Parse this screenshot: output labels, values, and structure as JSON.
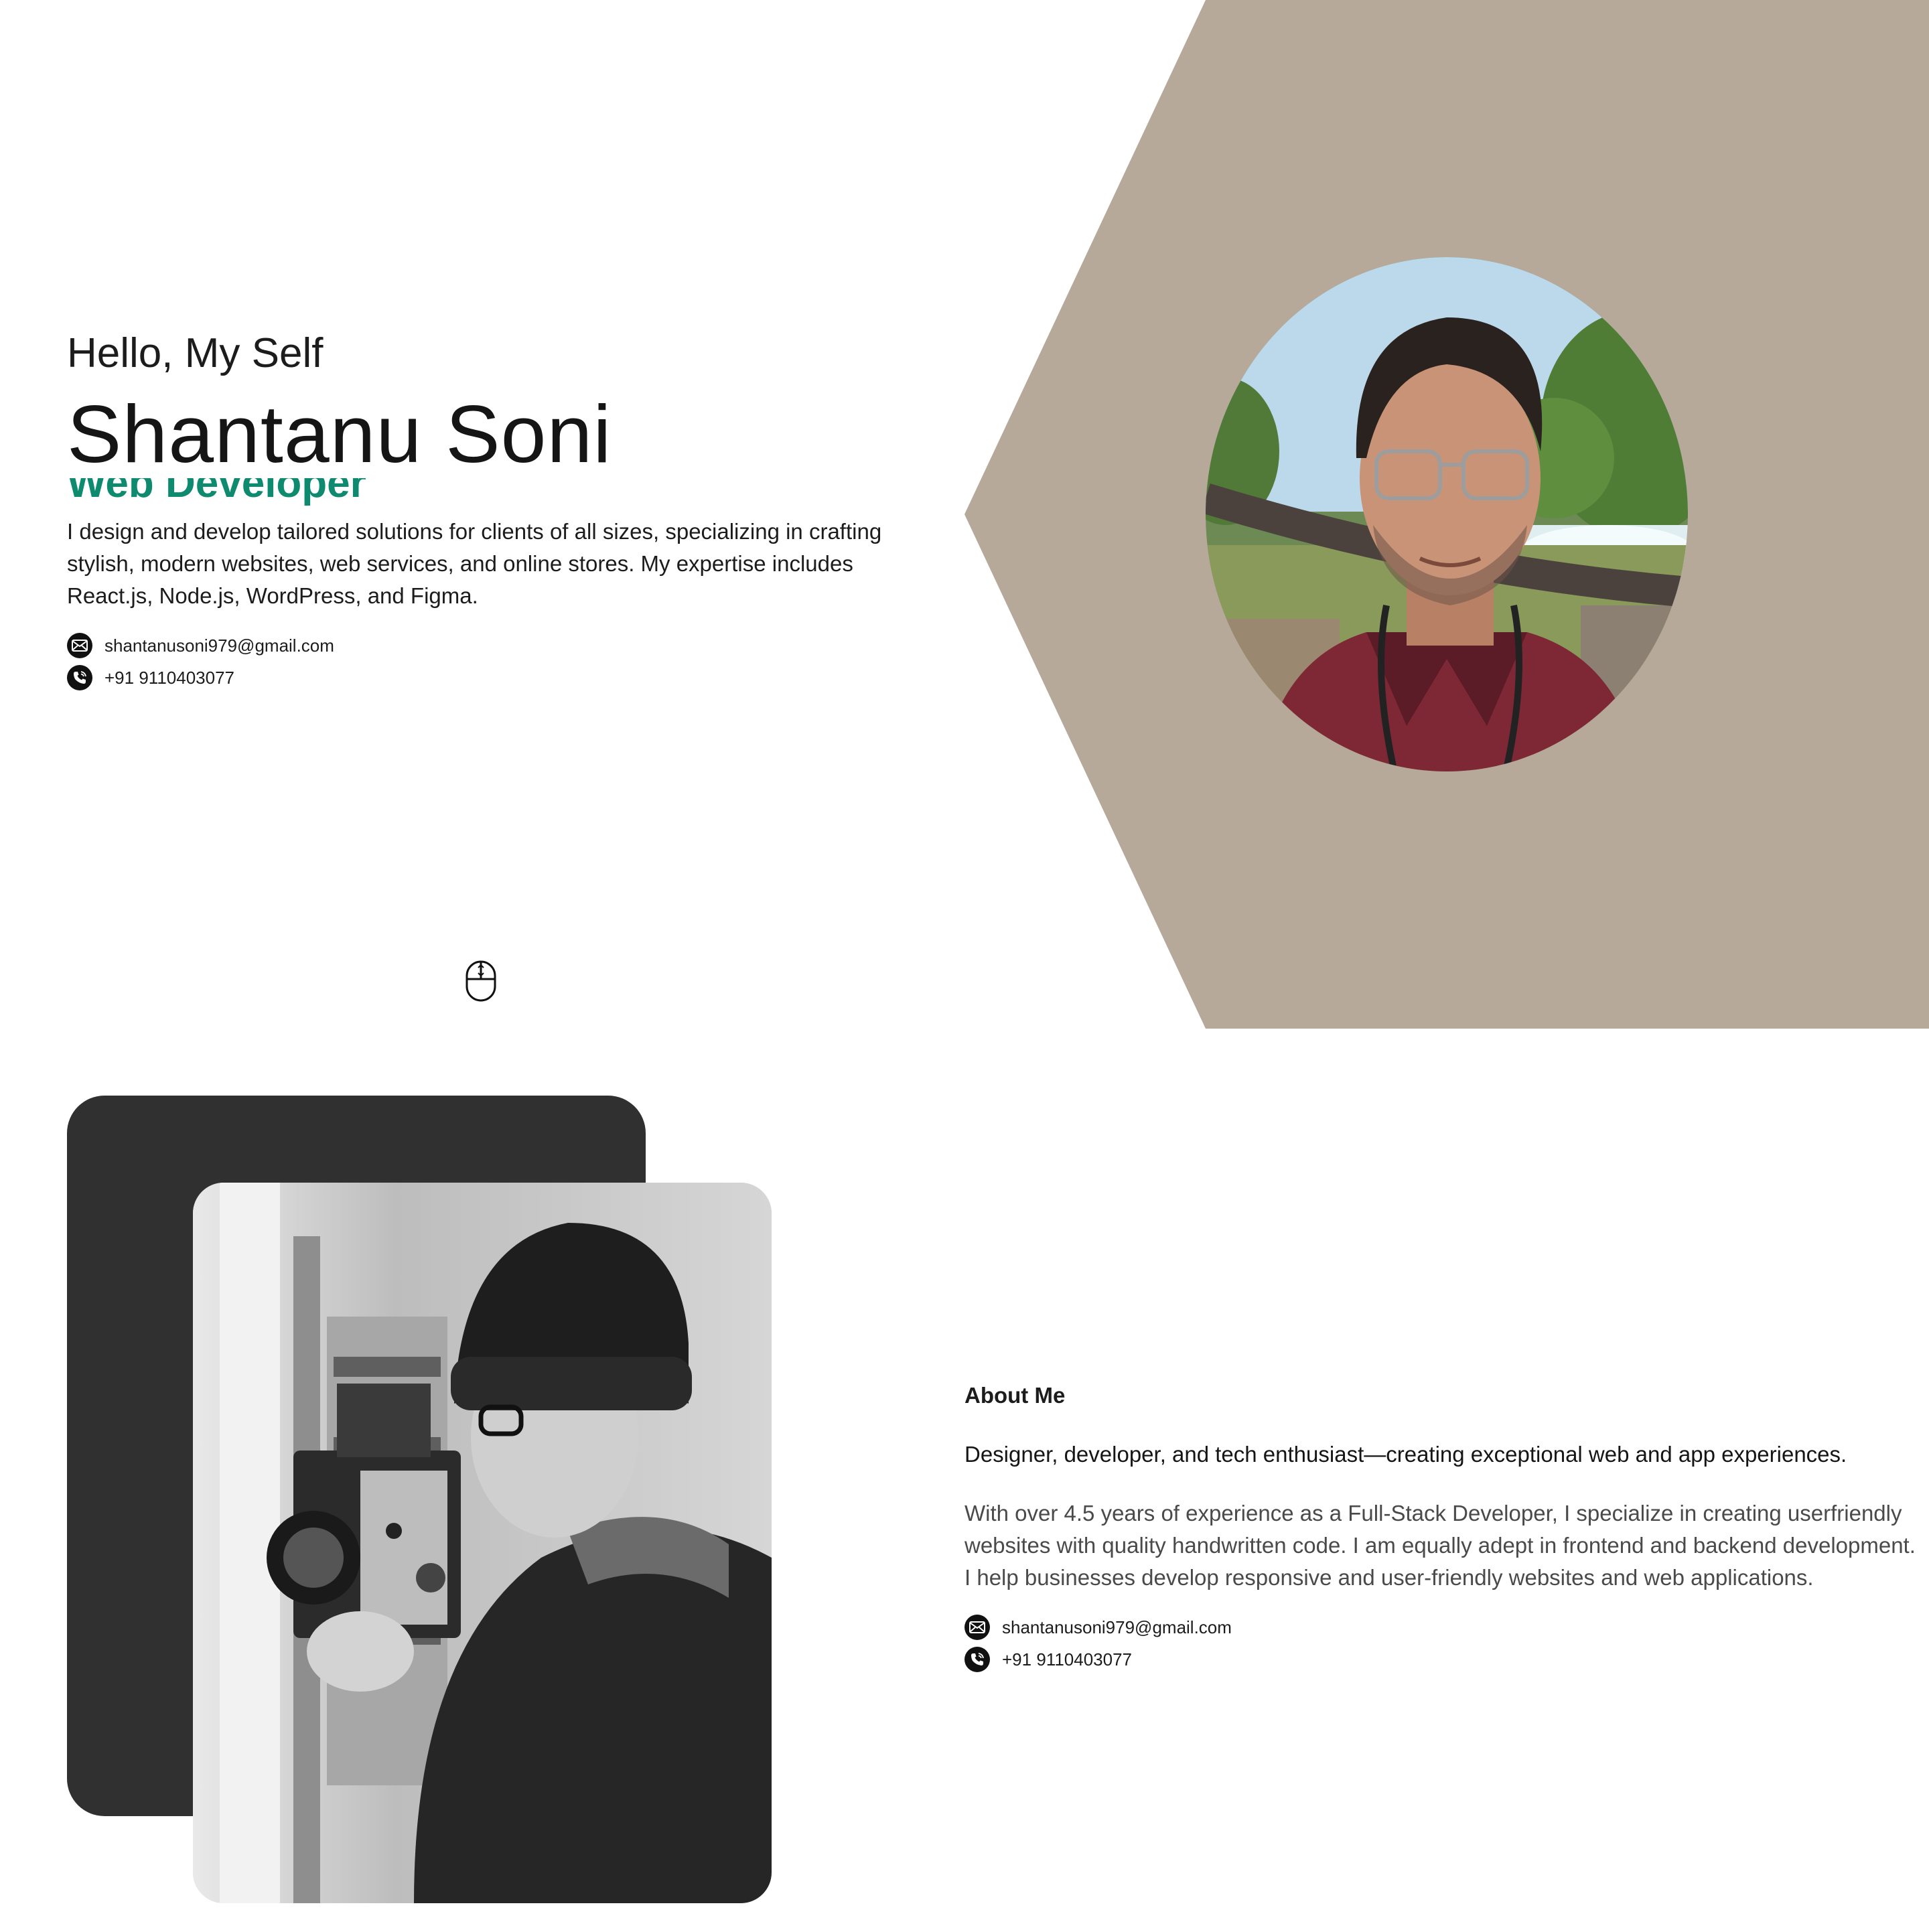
{
  "hero": {
    "greeting": "Hello, My Self",
    "name": "Shantanu Soni",
    "role": "Web Developer",
    "description": "I design and develop tailored solutions for clients of all sizes, specializing in crafting stylish, modern websites, web services, and online stores. My expertise includes React.js, Node.js, WordPress, and Figma.",
    "email": "shantanusoni979@gmail.com",
    "phone": "+91 9110403077",
    "portrait_alt": "Portrait of Shantanu Soni",
    "background_color": "#b6a999",
    "role_color": "#0e8a6e"
  },
  "about": {
    "heading": "About Me",
    "tagline": "Designer, developer, and tech enthusiast—creating exceptional web and app experiences.",
    "body": "With over 4.5 years of experience as a Full-Stack Developer, I specialize in creating userfriendly websites with quality handwritten code. I am equally adept in frontend and backend development. I help businesses develop responsive and user-friendly websites and web applications.",
    "email": "shantanusoni979@gmail.com",
    "phone": "+91 9110403077",
    "card_color": "#303030"
  },
  "icons": {
    "mail": "mail-icon",
    "phone": "phone-icon",
    "scroll": "mouse-scroll-icon"
  }
}
